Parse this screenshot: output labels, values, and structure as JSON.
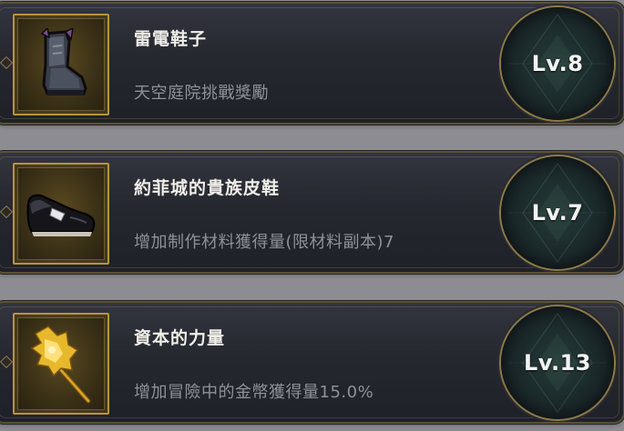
{
  "items": [
    {
      "name": "雷電鞋子",
      "description": "天空庭院挑戰獎勵",
      "level": "Lv.8",
      "icon": "armored-boot-icon"
    },
    {
      "name": "約菲城的貴族皮鞋",
      "description": "增加制作材料獲得量(限材料副本)7",
      "level": "Lv.7",
      "icon": "leather-shoe-icon"
    },
    {
      "name": "資本的力量",
      "description": "增加冒險中的金幣獲得量15.0%",
      "level": "Lv.13",
      "icon": "golden-scepter-icon"
    }
  ],
  "colors": {
    "frame_gold": "#b7953d",
    "card_bg": "#262830",
    "title_text": "#f1efe9",
    "desc_text": "#8f919a",
    "circle_bg": "#1c2c2c"
  }
}
